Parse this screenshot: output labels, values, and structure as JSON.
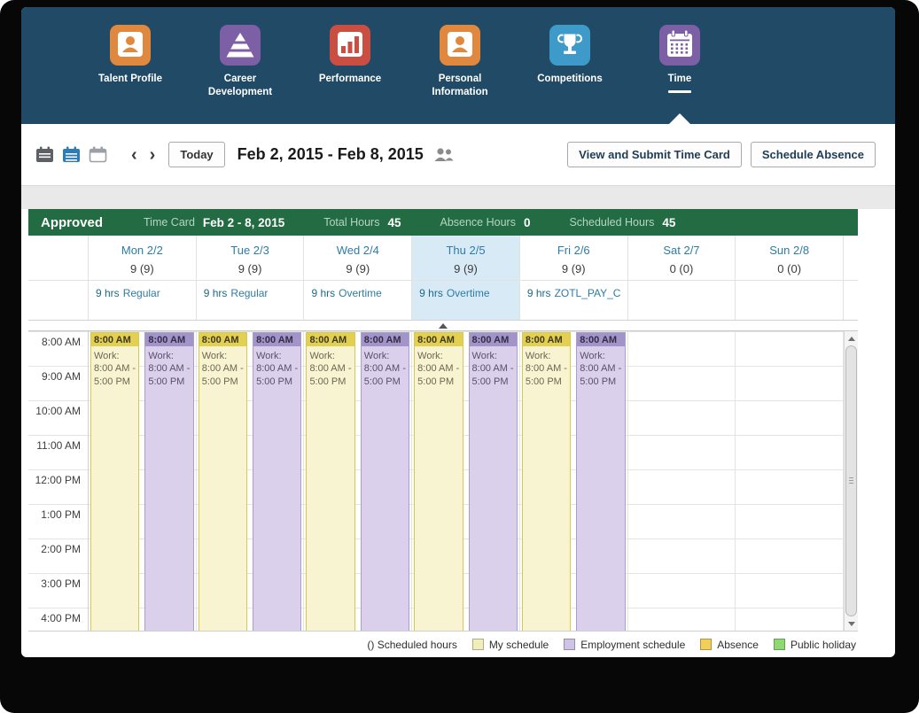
{
  "nav": {
    "items": [
      {
        "label": "Talent Profile"
      },
      {
        "label": "Career Development"
      },
      {
        "label": "Performance"
      },
      {
        "label": "Personal Information"
      },
      {
        "label": "Competitions"
      },
      {
        "label": "Time",
        "active": true
      }
    ],
    "icon_colors": {
      "talent_profile": "#e0883e",
      "career_development": "#7d5fa5",
      "performance": "#cb4e42",
      "personal_information": "#e0883e",
      "competitions": "#3e9bc9",
      "time": "#7d5fa5"
    }
  },
  "toolbar": {
    "prev": "‹",
    "next": "›",
    "today": "Today",
    "date_range": "Feb 2, 2015 - Feb 8, 2015",
    "view_submit": "View and Submit Time Card",
    "schedule_absence": "Schedule Absence"
  },
  "status_bar": {
    "color": "#226b43",
    "status": "Approved",
    "time_card_label": "Time Card",
    "time_card_value": "Feb 2 - 8, 2015",
    "total_hours_label": "Total Hours",
    "total_hours_value": "45",
    "absence_hours_label": "Absence Hours",
    "absence_hours_value": "0",
    "scheduled_hours_label": "Scheduled Hours",
    "scheduled_hours_value": "45"
  },
  "week": {
    "days": [
      {
        "name": "Mon 2/2",
        "hours": "9 (9)",
        "detail_hours": "9 hrs",
        "detail_type": "Regular"
      },
      {
        "name": "Tue 2/3",
        "hours": "9 (9)",
        "detail_hours": "9 hrs",
        "detail_type": "Regular"
      },
      {
        "name": "Wed 2/4",
        "hours": "9 (9)",
        "detail_hours": "9 hrs",
        "detail_type": "Overtime"
      },
      {
        "name": "Thu 2/5",
        "hours": "9 (9)",
        "detail_hours": "9 hrs",
        "detail_type": "Overtime",
        "selected": true
      },
      {
        "name": "Fri 2/6",
        "hours": "9 (9)",
        "detail_hours": "9 hrs",
        "detail_type": "ZOTL_PAY_C"
      },
      {
        "name": "Sat 2/7",
        "hours": "0 (0)",
        "detail_hours": "",
        "detail_type": ""
      },
      {
        "name": "Sun 2/8",
        "hours": "0 (0)",
        "detail_hours": "",
        "detail_type": ""
      }
    ]
  },
  "grid": {
    "times": [
      "8:00 AM",
      "9:00 AM",
      "10:00 AM",
      "11:00 AM",
      "12:00 PM",
      "1:00 PM",
      "2:00 PM",
      "3:00 PM",
      "4:00 PM"
    ],
    "event": {
      "start": "8:00 AM",
      "my_label": "Work: 8:00 AM - 5:00 PM",
      "employment_label": "Work: 8:00 AM - 5:00 PM"
    },
    "event_colors": {
      "my_header": "#e3d051",
      "my_body": "#f8f4d2",
      "employment_header": "#a294c8",
      "employment_body": "#dad0ec"
    }
  },
  "legend": {
    "scheduled_note": "() Scheduled hours",
    "items": [
      {
        "label": "My schedule",
        "color": "#f2eebb"
      },
      {
        "label": "Employment schedule",
        "color": "#cfc3e6"
      },
      {
        "label": "Absence",
        "color": "#f2cf5b"
      },
      {
        "label": "Public holiday",
        "color": "#8ed973"
      }
    ]
  }
}
